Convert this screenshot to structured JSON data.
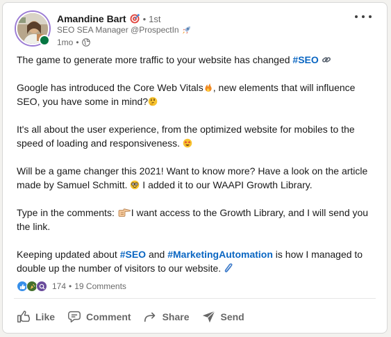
{
  "author": {
    "name": "Amandine Bart",
    "name_badge_icon": "target-emoji",
    "separator": "•",
    "degree": "1st",
    "headline": "SEO SEA Manager @ProspectIn",
    "headline_icon": "rocket-emoji",
    "time": "1mo",
    "time_separator": "•",
    "visibility_icon": "globe-icon",
    "presence": "online"
  },
  "post": {
    "p1": {
      "text": "The game to generate more traffic to your website has changed ",
      "tag": "#SEO",
      "emoji": "link-emoji"
    },
    "p2": {
      "a": "Google has introduced the Core Web Vitals",
      "a_emoji": "fire-emoji",
      "b": ", new elements that will influence SEO, you have some in mind?",
      "b_emoji": "thinking-emoji"
    },
    "p3": {
      "text": "It's all about the user experience, from the optimized website for mobiles to the speed of loading and responsiveness. ",
      "emoji": "star-struck-emoji"
    },
    "p4": {
      "a": "Will be a game changer this 2021! Want to know more? Have a look on the article made by Samuel Schmitt. ",
      "a_emoji": "nerd-emoji",
      "b": " I added it to our WAAPI Growth Library."
    },
    "p5": {
      "a": "Type in the comments: ",
      "a_emoji": "pointing-right-emoji",
      "b": "I want access to the Growth Library, and I will send you the link."
    },
    "p6": {
      "a": "Keeping updated about ",
      "tag1": "#SEO",
      "b": " and ",
      "tag2": "#MarketingAutomation",
      "c": " is how I managed to double up the number of visitors to our website. ",
      "c_emoji": "paperclip-emoji"
    }
  },
  "social": {
    "reaction_icons": [
      "like-reaction-icon",
      "celebrate-reaction-icon",
      "curious-reaction-icon"
    ],
    "reaction_count": "174",
    "separator": "•",
    "comments": "19 Comments"
  },
  "actions": [
    {
      "label": "Like",
      "icon": "like-icon"
    },
    {
      "label": "Comment",
      "icon": "comment-icon"
    },
    {
      "label": "Share",
      "icon": "share-icon"
    },
    {
      "label": "Send",
      "icon": "send-icon"
    }
  ],
  "colors": {
    "hashtag": "#0a66c2",
    "presence": "#057642",
    "avatar_ring": "#9b7bd4",
    "secondary_text": "#666666"
  }
}
